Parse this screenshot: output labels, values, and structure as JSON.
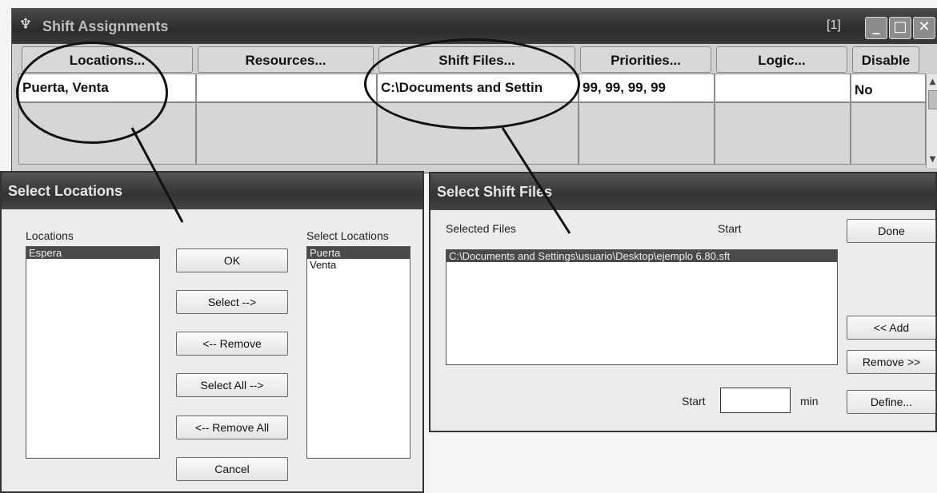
{
  "main": {
    "title": "Shift Assignments",
    "count": "[1]",
    "buttons": {
      "minimize": "_",
      "maximize": "□",
      "close": "✕"
    },
    "columns": [
      "Locations...",
      "Resources...",
      "Shift Files...",
      "Priorities...",
      "Logic...",
      "Disable"
    ],
    "row": {
      "locations": "Puerta, Venta",
      "resources": "",
      "shift_files": "C:\\Documents and Settin",
      "priorities": "99, 99, 99, 99",
      "logic": "",
      "disable": "No"
    }
  },
  "select_locations": {
    "title": "Select Locations",
    "locations_label": "Locations",
    "locations_items": [
      "Espera"
    ],
    "selected_label": "Select Locations",
    "selected_items": [
      "Puerta",
      "Venta"
    ],
    "buttons": {
      "ok": "OK",
      "select": "Select -->",
      "remove": "<-- Remove",
      "select_all": "Select All -->",
      "remove_all": "<-- Remove All",
      "cancel": "Cancel"
    }
  },
  "select_shift_files": {
    "title": "Select Shift Files",
    "selected_files_label": "Selected Files",
    "start_header": "Start",
    "files": [
      "C:\\Documents and Settings\\usuario\\Desktop\\ejemplo 6.80.sft"
    ],
    "start_label": "Start",
    "start_value": "",
    "unit": "min",
    "buttons": {
      "done": "Done",
      "add": "<< Add",
      "remove": "Remove >>",
      "define": "Define..."
    }
  },
  "icons": {
    "app": "app-icon"
  }
}
